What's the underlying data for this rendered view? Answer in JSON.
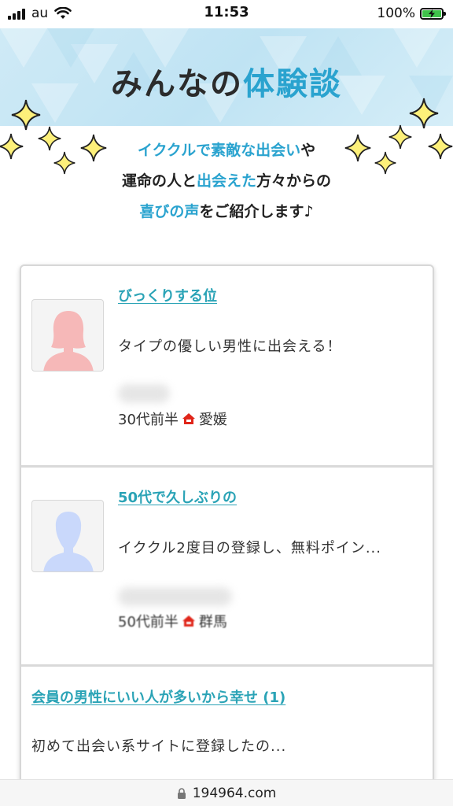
{
  "status_bar": {
    "carrier": "au",
    "time": "11:53",
    "battery": "100%"
  },
  "banner": {
    "title_prefix": "みんなの",
    "title_highlight": "体験談"
  },
  "intro": {
    "line1_highlight": "イククルで素敵な出会い",
    "line1_suffix": "や",
    "line2_prefix": "運命の人と",
    "line2_highlight": "出会えた",
    "line2_suffix": "方々からの",
    "line3_highlight": "喜びの声",
    "line3_suffix": "をご紹介します♪"
  },
  "testimonials": [
    {
      "title": "びっくりする位",
      "text": "タイプの優しい男性に出会える！",
      "age": "30代前半",
      "region": "愛媛",
      "avatar": "female-silhouette-icon"
    },
    {
      "title": "50代で久しぶりの",
      "text": "イククル2度目の登録し、無料ポイン...",
      "age": "50代前半",
      "region": "群馬",
      "avatar": "male-silhouette-icon"
    },
    {
      "title": "会員の男性にいい人が多いから幸せ (1)",
      "text": "初めて出会い系サイトに登録したの..."
    }
  ],
  "url_bar": {
    "domain": "194964.com"
  },
  "colors": {
    "accent": "#2aa3cf",
    "link": "#2aa3b6",
    "banner_bg": "#c6e6f4",
    "region_icon": "#e0261a"
  }
}
